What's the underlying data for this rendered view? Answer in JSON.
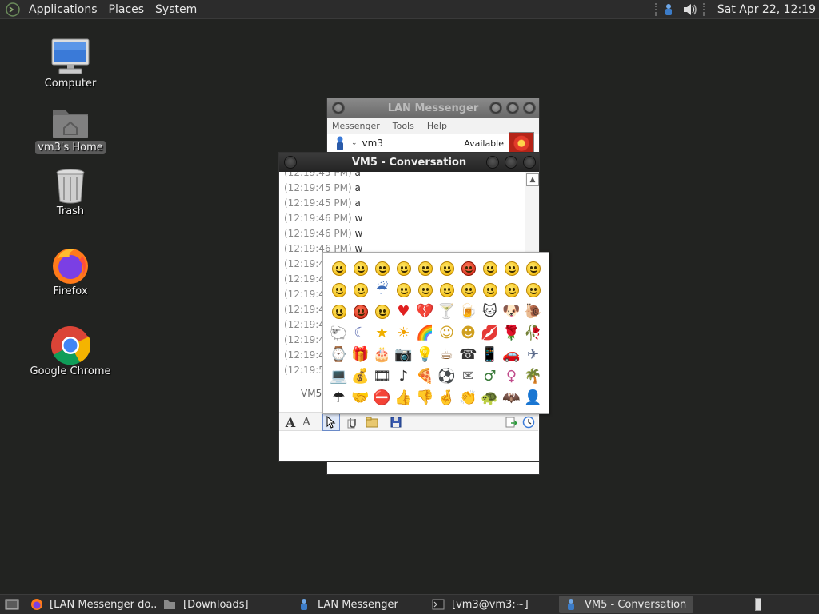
{
  "top_panel": {
    "menus": [
      "Applications",
      "Places",
      "System"
    ],
    "clock": "Sat Apr 22, 12:19"
  },
  "desktop_icons": [
    {
      "label": "Computer",
      "icon": "computer-icon"
    },
    {
      "label": "vm3's Home",
      "icon": "home-folder-icon",
      "selected": true
    },
    {
      "label": "Trash",
      "icon": "trash-icon"
    },
    {
      "label": "Firefox",
      "icon": "firefox-icon"
    },
    {
      "label": "Google Chrome",
      "icon": "chrome-icon"
    }
  ],
  "lan_messenger": {
    "title": "LAN Messenger",
    "menu": [
      "Messenger",
      "Tools",
      "Help"
    ],
    "user": "vm3",
    "status": "Available"
  },
  "conversation": {
    "title": "VM5 - Conversation",
    "sender_label": "VM5",
    "messages": [
      {
        "time": "(12:19:45 PM)",
        "text": "a"
      },
      {
        "time": "(12:19:45 PM)",
        "text": "a"
      },
      {
        "time": "(12:19:45 PM)",
        "text": "a"
      },
      {
        "time": "(12:19:46 PM)",
        "text": "w"
      },
      {
        "time": "(12:19:46 PM)",
        "text": "w"
      },
      {
        "time": "(12:19:46 PM)",
        "text": "w"
      },
      {
        "time": "(12:19:4",
        "text": ""
      },
      {
        "time": "(12:19:4",
        "text": ""
      },
      {
        "time": "(12:19:4",
        "text": ""
      },
      {
        "time": "(12:19:4",
        "text": ""
      },
      {
        "time": "(12:19:4",
        "text": ""
      },
      {
        "time": "(12:19:4",
        "text": ""
      },
      {
        "time": "(12:19:4",
        "text": ""
      },
      {
        "time": "(12:19:5",
        "text": ""
      }
    ]
  },
  "emoticons": [
    "smile",
    "grin",
    "wink",
    "surprised",
    "tongue",
    "cool",
    "angry",
    "confused",
    "crying",
    "sad",
    "shy",
    "embarrassed",
    "storm",
    "teeth",
    "nerd",
    "sarcastic",
    "secret",
    "yawn",
    "sick",
    "sleepy",
    "not-telling",
    "mad",
    "thinking",
    "heart",
    "broken-heart",
    "martini",
    "beer",
    "cat",
    "dog",
    "snail",
    "sheep",
    "moon",
    "star",
    "sun",
    "rainbow",
    "hug",
    "hug-girl",
    "kiss",
    "rose",
    "wilted-rose",
    "clock",
    "gift",
    "cake",
    "camera",
    "idea",
    "coffee",
    "phone",
    "mobile",
    "car",
    "airplane",
    "computer",
    "money",
    "film",
    "music",
    "pizza",
    "soccer",
    "mail",
    "man",
    "woman",
    "island",
    "umbrella",
    "handshake",
    "stop",
    "thumbs-up",
    "thumbs-down",
    "fingers-crossed",
    "clap",
    "turtle",
    "bat",
    "messenger"
  ],
  "taskbar": {
    "items": [
      {
        "label": "[LAN Messenger do...",
        "icon": "firefox-icon",
        "active": false
      },
      {
        "label": "[Downloads]",
        "icon": "folder-icon",
        "active": false
      },
      {
        "label": "LAN Messenger",
        "icon": "messenger-icon",
        "active": false
      },
      {
        "label": "[vm3@vm3:~]",
        "icon": "terminal-icon",
        "active": false
      },
      {
        "label": "VM5 - Conversation",
        "icon": "messenger-icon",
        "active": true
      }
    ]
  }
}
